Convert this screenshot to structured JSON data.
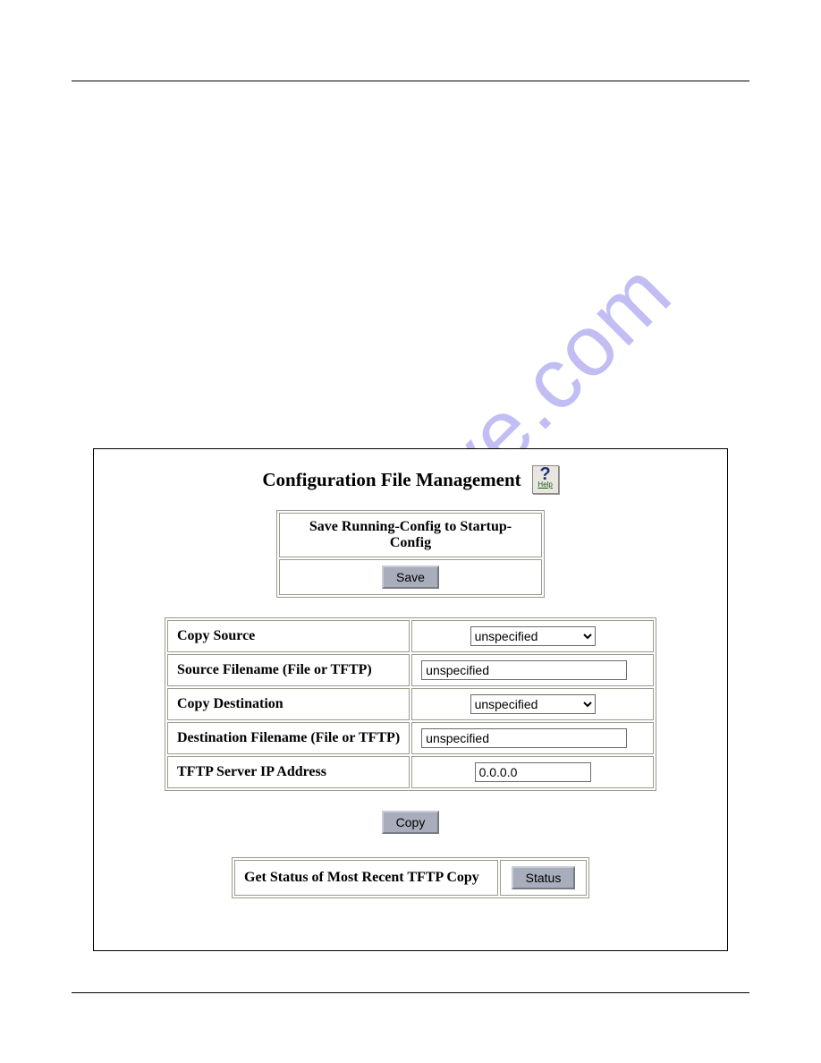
{
  "watermark": "manualshive.com",
  "panel": {
    "title": "Configuration File Management",
    "help_label": "Help",
    "save_section": {
      "header": "Save Running-Config to Startup-Config",
      "button": "Save"
    },
    "copy_section": {
      "rows": {
        "copy_source": {
          "label": "Copy Source",
          "value": "unspecified"
        },
        "source_filename": {
          "label": "Source Filename (File or TFTP)",
          "value": "unspecified"
        },
        "copy_destination": {
          "label": "Copy Destination",
          "value": "unspecified"
        },
        "destination_filename": {
          "label": "Destination Filename (File or TFTP)",
          "value": "unspecified"
        },
        "tftp_ip": {
          "label": "TFTP Server IP Address",
          "value": "0.0.0.0"
        }
      },
      "copy_button": "Copy"
    },
    "status_section": {
      "label": "Get Status of Most Recent TFTP Copy",
      "button": "Status"
    }
  }
}
